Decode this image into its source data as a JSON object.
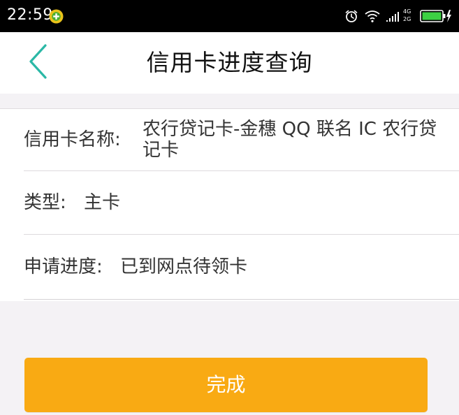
{
  "status_bar": {
    "time": "22:59",
    "network_top": "4G",
    "network_bottom": "2G",
    "icons": [
      "app-notification-icon",
      "alarm-clock-icon",
      "wifi-icon",
      "signal-bars-icon",
      "battery-charging-icon"
    ]
  },
  "nav": {
    "title": "信用卡进度查询",
    "back_icon": "chevron-left-icon"
  },
  "details": {
    "card_name_label": "信用卡名称:",
    "card_name_value": "农行贷记卡-金穗 QQ 联名 IC 农行贷记卡",
    "type_label": "类型:",
    "type_value": "主卡",
    "progress_label": "申请进度:",
    "progress_value": "已到网点待领卡"
  },
  "actions": {
    "done_label": "完成"
  },
  "colors": {
    "accent_teal": "#2bb8a6",
    "button_orange": "#f9aa13",
    "background_gray": "#f4f2f5"
  }
}
